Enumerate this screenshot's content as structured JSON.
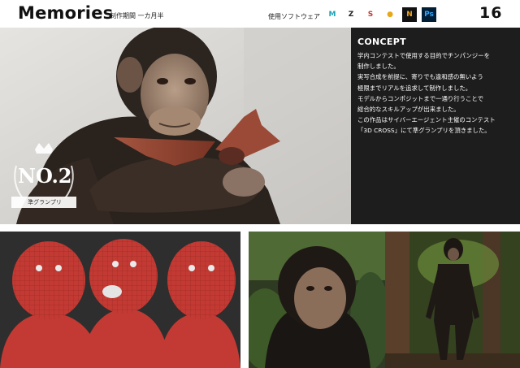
{
  "header": {
    "title": "Memories",
    "period": "制作期間 一カ月半",
    "software_label": "使用ソフトウェア",
    "software": [
      {
        "icon": "maya-icon",
        "glyph": "M",
        "color": "#19a3b5",
        "bg": "#ffffff"
      },
      {
        "icon": "zbrush-icon",
        "glyph": "Z",
        "color": "#222222",
        "bg": "#ffffff"
      },
      {
        "icon": "substance-icon",
        "glyph": "S",
        "color": "#c3382f",
        "bg": "#ffffff"
      },
      {
        "icon": "marmoset-icon",
        "glyph": "●",
        "color": "#e6a819",
        "bg": "#ffffff"
      },
      {
        "icon": "nuke-icon",
        "glyph": "N",
        "color": "#f3a41c",
        "bg": "#111111"
      },
      {
        "icon": "photoshop-icon",
        "glyph": "Ps",
        "color": "#31a8ff",
        "bg": "#001e36"
      }
    ],
    "page_number": "16"
  },
  "concept": {
    "heading": "CONCEPT",
    "lines": [
      "学内コンテストで使用する目的でチンパンジーを",
      "制作しました。",
      "実写合成を前提に、寄りでも違和感の無いよう",
      "極限までリアルを追求して制作しました。",
      "モデルからコンポジットまで一通り行うことで",
      "総合的なスキルアップが出来ました。",
      "この作品はサイバーエージェント主催のコンテスト",
      "「3D CROSS」にて準グランプリを頂きました。"
    ]
  },
  "award": {
    "rank": "NO.2",
    "label": "準グランプリ"
  },
  "colors": {
    "panel": "#1d1d1d",
    "wireframe_red": "#c23a33"
  }
}
